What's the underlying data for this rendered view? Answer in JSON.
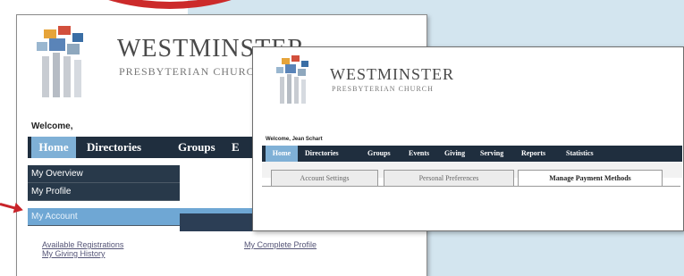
{
  "back_window": {
    "logo": {
      "name": "WESTMINSTER",
      "subtitle": "PRESBYTERIAN CHURCH"
    },
    "welcome": "Welcome,",
    "nav": {
      "home": "Home",
      "directories": "Directories",
      "groups": "Groups",
      "partial": "E"
    },
    "dropdown": {
      "overview": "My Overview",
      "profile": "My Profile",
      "account": "My Account"
    },
    "links": {
      "available_registrations": "Available Registrations",
      "giving_history": "My Giving History",
      "complete_profile": "My Complete Profile"
    }
  },
  "front_window": {
    "logo": {
      "name": "WESTMINSTER",
      "subtitle": "PRESBYTERIAN CHURCH"
    },
    "welcome": "Welcome, Jean Schart",
    "nav": {
      "home": "Home",
      "directories": "Directories",
      "groups": "Groups",
      "events": "Events",
      "giving": "Giving",
      "serving": "Serving",
      "reports": "Reports",
      "statistics": "Statistics"
    },
    "tabs": [
      {
        "label": "Account Settings"
      },
      {
        "label": "Personal Preferences"
      },
      {
        "label": "Manage Payment Methods"
      }
    ],
    "active_tab": "Manage Payment Methods"
  },
  "colors": {
    "accent_red": "#c8242a",
    "nav_dark": "#1f2e3e",
    "nav_highlight": "#7fb0d6",
    "background_blue": "#d3e5ef"
  }
}
